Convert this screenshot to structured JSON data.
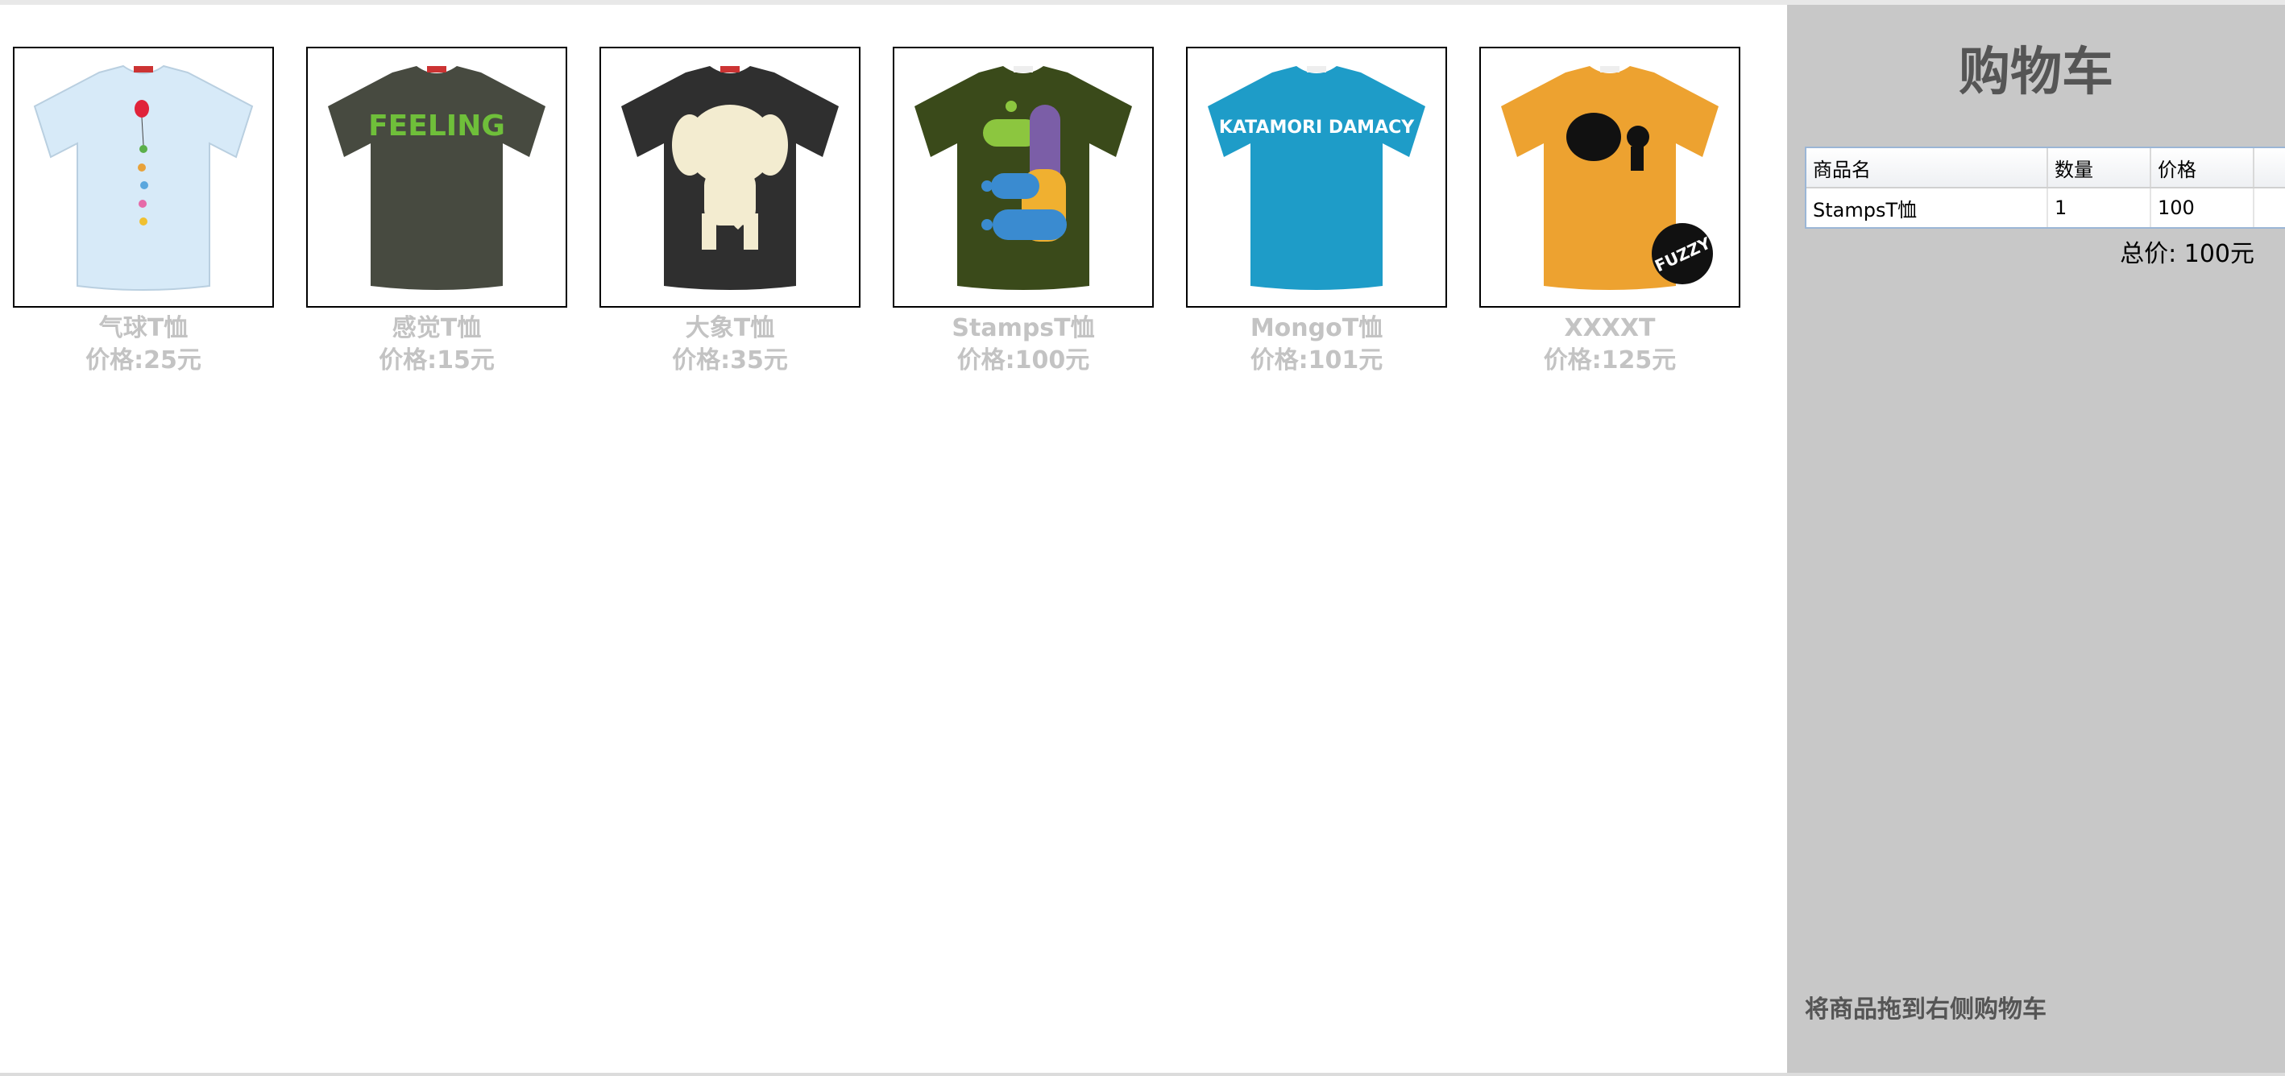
{
  "products": [
    {
      "name": "气球T恤",
      "price": "价格:25元",
      "shirt_color": "#d7eaf8",
      "art_icon": "balloon-art-icon"
    },
    {
      "name": "感觉T恤",
      "price": "价格:15元",
      "shirt_color": "#474a40",
      "art_icon": "feeling-text-art-icon",
      "art_text": "FEELING"
    },
    {
      "name": "大象T恤",
      "price": "价格:35元",
      "shirt_color": "#2f2f2f",
      "art_icon": "elephant-art-icon"
    },
    {
      "name": "StampsT恤",
      "price": "价格:100元",
      "shirt_color": "#3a4a1a",
      "art_icon": "stamps-art-icon"
    },
    {
      "name": "MongoT恤",
      "price": "价格:101元",
      "shirt_color": "#1e9cc8",
      "art_icon": "katamori-text-art-icon",
      "art_text": "KATAMORI DAMACY"
    },
    {
      "name": "XXXXT",
      "price": "价格:125元",
      "shirt_color": "#eda230",
      "art_icon": "fuzzy-art-icon",
      "art_text": "FUZZY"
    }
  ],
  "cart": {
    "title": "购物车",
    "columns": [
      "商品名",
      "数量",
      "价格"
    ],
    "rows": [
      {
        "name": "StampsT恤",
        "qty": "1",
        "price": "100"
      }
    ],
    "total": "总价: 100元",
    "hint": "将商品拖到右侧购物车"
  }
}
